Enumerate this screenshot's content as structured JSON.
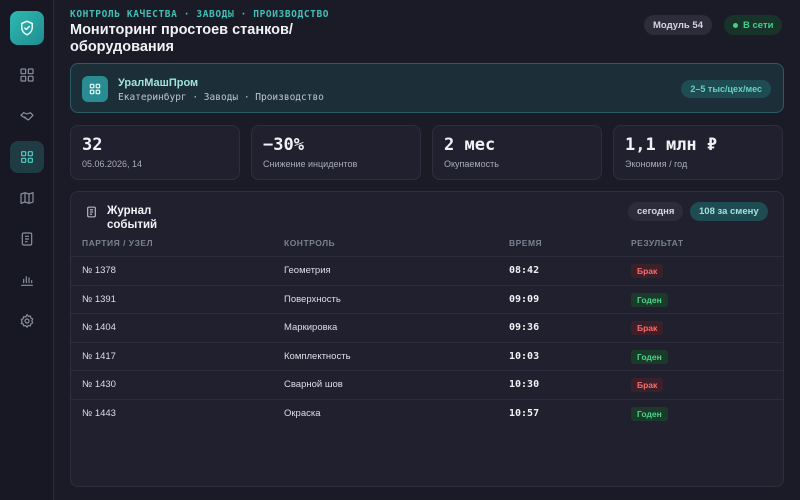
{
  "header": {
    "breadcrumb": "КОНТРОЛЬ КАЧЕСТВА · ЗАВОДЫ · ПРОИЗВОДСТВО",
    "title": "Мониторинг простоев станков/ оборудования",
    "module_badge": "Модуль 54",
    "online_badge": "В сети"
  },
  "sidebar": {
    "items": [
      {
        "icon": "dashboard-icon"
      },
      {
        "icon": "handshake-icon"
      },
      {
        "icon": "grid-icon",
        "active": true
      },
      {
        "icon": "map-icon"
      },
      {
        "icon": "document-icon"
      },
      {
        "icon": "bar-chart-icon"
      },
      {
        "icon": "gear-icon"
      }
    ]
  },
  "company": {
    "name": "УралМашПром",
    "subtitle": "Екатеринбург · Заводы · Производство",
    "badge": "2–5 тыс/цех/мес"
  },
  "stats": [
    {
      "value": "32",
      "label": "05.06.2026, 14"
    },
    {
      "value": "−30%",
      "label": "Снижение инцидентов"
    },
    {
      "value": "2 мес",
      "label": "Окупаемость"
    },
    {
      "value": "1,1 млн ₽",
      "label": "Экономия / год"
    }
  ],
  "log": {
    "title": "Журнал событий",
    "today": "сегодня",
    "shift_count": "108 за смену",
    "columns": [
      "ПАРТИЯ / УЗЕЛ",
      "КОНТРОЛЬ",
      "ВРЕМЯ",
      "РЕЗУЛЬТАТ"
    ],
    "rows": [
      {
        "batch": "№ 1378",
        "control": "Геометрия",
        "time": "08:42",
        "result": "Брак"
      },
      {
        "batch": "№ 1391",
        "control": "Поверхность",
        "time": "09:09",
        "result": "Годен"
      },
      {
        "batch": "№ 1404",
        "control": "Маркировка",
        "time": "09:36",
        "result": "Брак"
      },
      {
        "batch": "№ 1417",
        "control": "Комплектность",
        "time": "10:03",
        "result": "Годен"
      },
      {
        "batch": "№ 1430",
        "control": "Сварной шов",
        "time": "10:30",
        "result": "Брак"
      },
      {
        "batch": "№ 1443",
        "control": "Окраска",
        "time": "10:57",
        "result": "Годен"
      }
    ]
  },
  "colors": {
    "accent": "#3fc1b6",
    "bad": "#ff6b6b",
    "good": "#4ad58a"
  }
}
